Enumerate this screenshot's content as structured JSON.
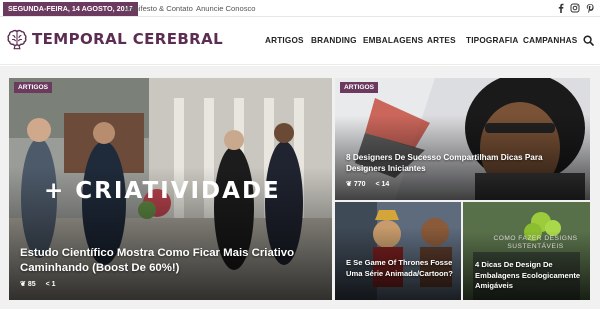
{
  "topbar": {
    "date": "SEGUNDA-FEIRA, 14 AGOSTO, 2017",
    "links": [
      "Manifesto & Contato",
      "Anuncie Conosco"
    ],
    "social_icons": [
      "facebook-icon",
      "instagram-icon",
      "pinterest-icon"
    ]
  },
  "header": {
    "logo_text": "TEMPORAL CEREBRAL",
    "nav": [
      "ARTIGOS",
      "BRANDING",
      "EMBALAGENS",
      "ARTES",
      "TIPOGRAFIA",
      "CAMPANHAS"
    ],
    "search_icon": "search-icon"
  },
  "colors": {
    "brand": "#5b2d52",
    "tag": "#6b3a5e"
  },
  "featured": {
    "main": {
      "tag": "ARTIGOS",
      "image_text": "+ CRIATIVIDADE",
      "title": "Estudo Científico Mostra Como Ficar Mais Criativo Caminhando (Boost De 60%!)",
      "views": "85",
      "shares": "1"
    },
    "top_right": {
      "tag": "ARTIGOS",
      "title": "8 Designers De Sucesso Compartilham Dicas Para Designers Iniciantes",
      "views": "770",
      "shares": "14"
    },
    "bottom_left": {
      "title": "E Se Game Of Thrones Fosse Uma Série Animada/Cartoon?"
    },
    "bottom_right": {
      "image_text": "COMO FAZER DESIGNS SUSTENTÁVEIS",
      "title": "4 Dicas De Design De Embalagens Ecologicamente Amigáveis"
    }
  }
}
